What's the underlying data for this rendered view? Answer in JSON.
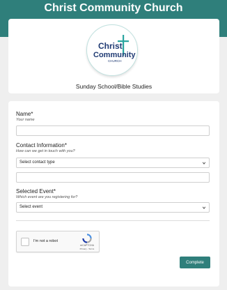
{
  "header": {
    "title": "Christ Community Church"
  },
  "logo": {
    "line1": "Christ",
    "line2": "Community",
    "line3": "CHURCH",
    "brand_color": "#1f3a73",
    "accent_color": "#2aa5a0"
  },
  "page": {
    "subtitle": "Sunday School/Bible Studies"
  },
  "form": {
    "name": {
      "label": "Name*",
      "hint": "Your name",
      "value": ""
    },
    "contact": {
      "label": "Contact Information*",
      "hint": "How can we get in touch with you?",
      "selected": "Select contact type",
      "detail_value": ""
    },
    "event": {
      "label": "Selected Event*",
      "hint": "Which event are you registering for?",
      "selected": "Select event"
    },
    "captcha": {
      "text": "I'm not a robot",
      "brand": "reCAPTCHA",
      "privacy": "Privacy",
      "terms": "Terms"
    },
    "submit_label": "Complete"
  },
  "colors": {
    "primary": "#2f7f7b",
    "background": "#efefef"
  }
}
